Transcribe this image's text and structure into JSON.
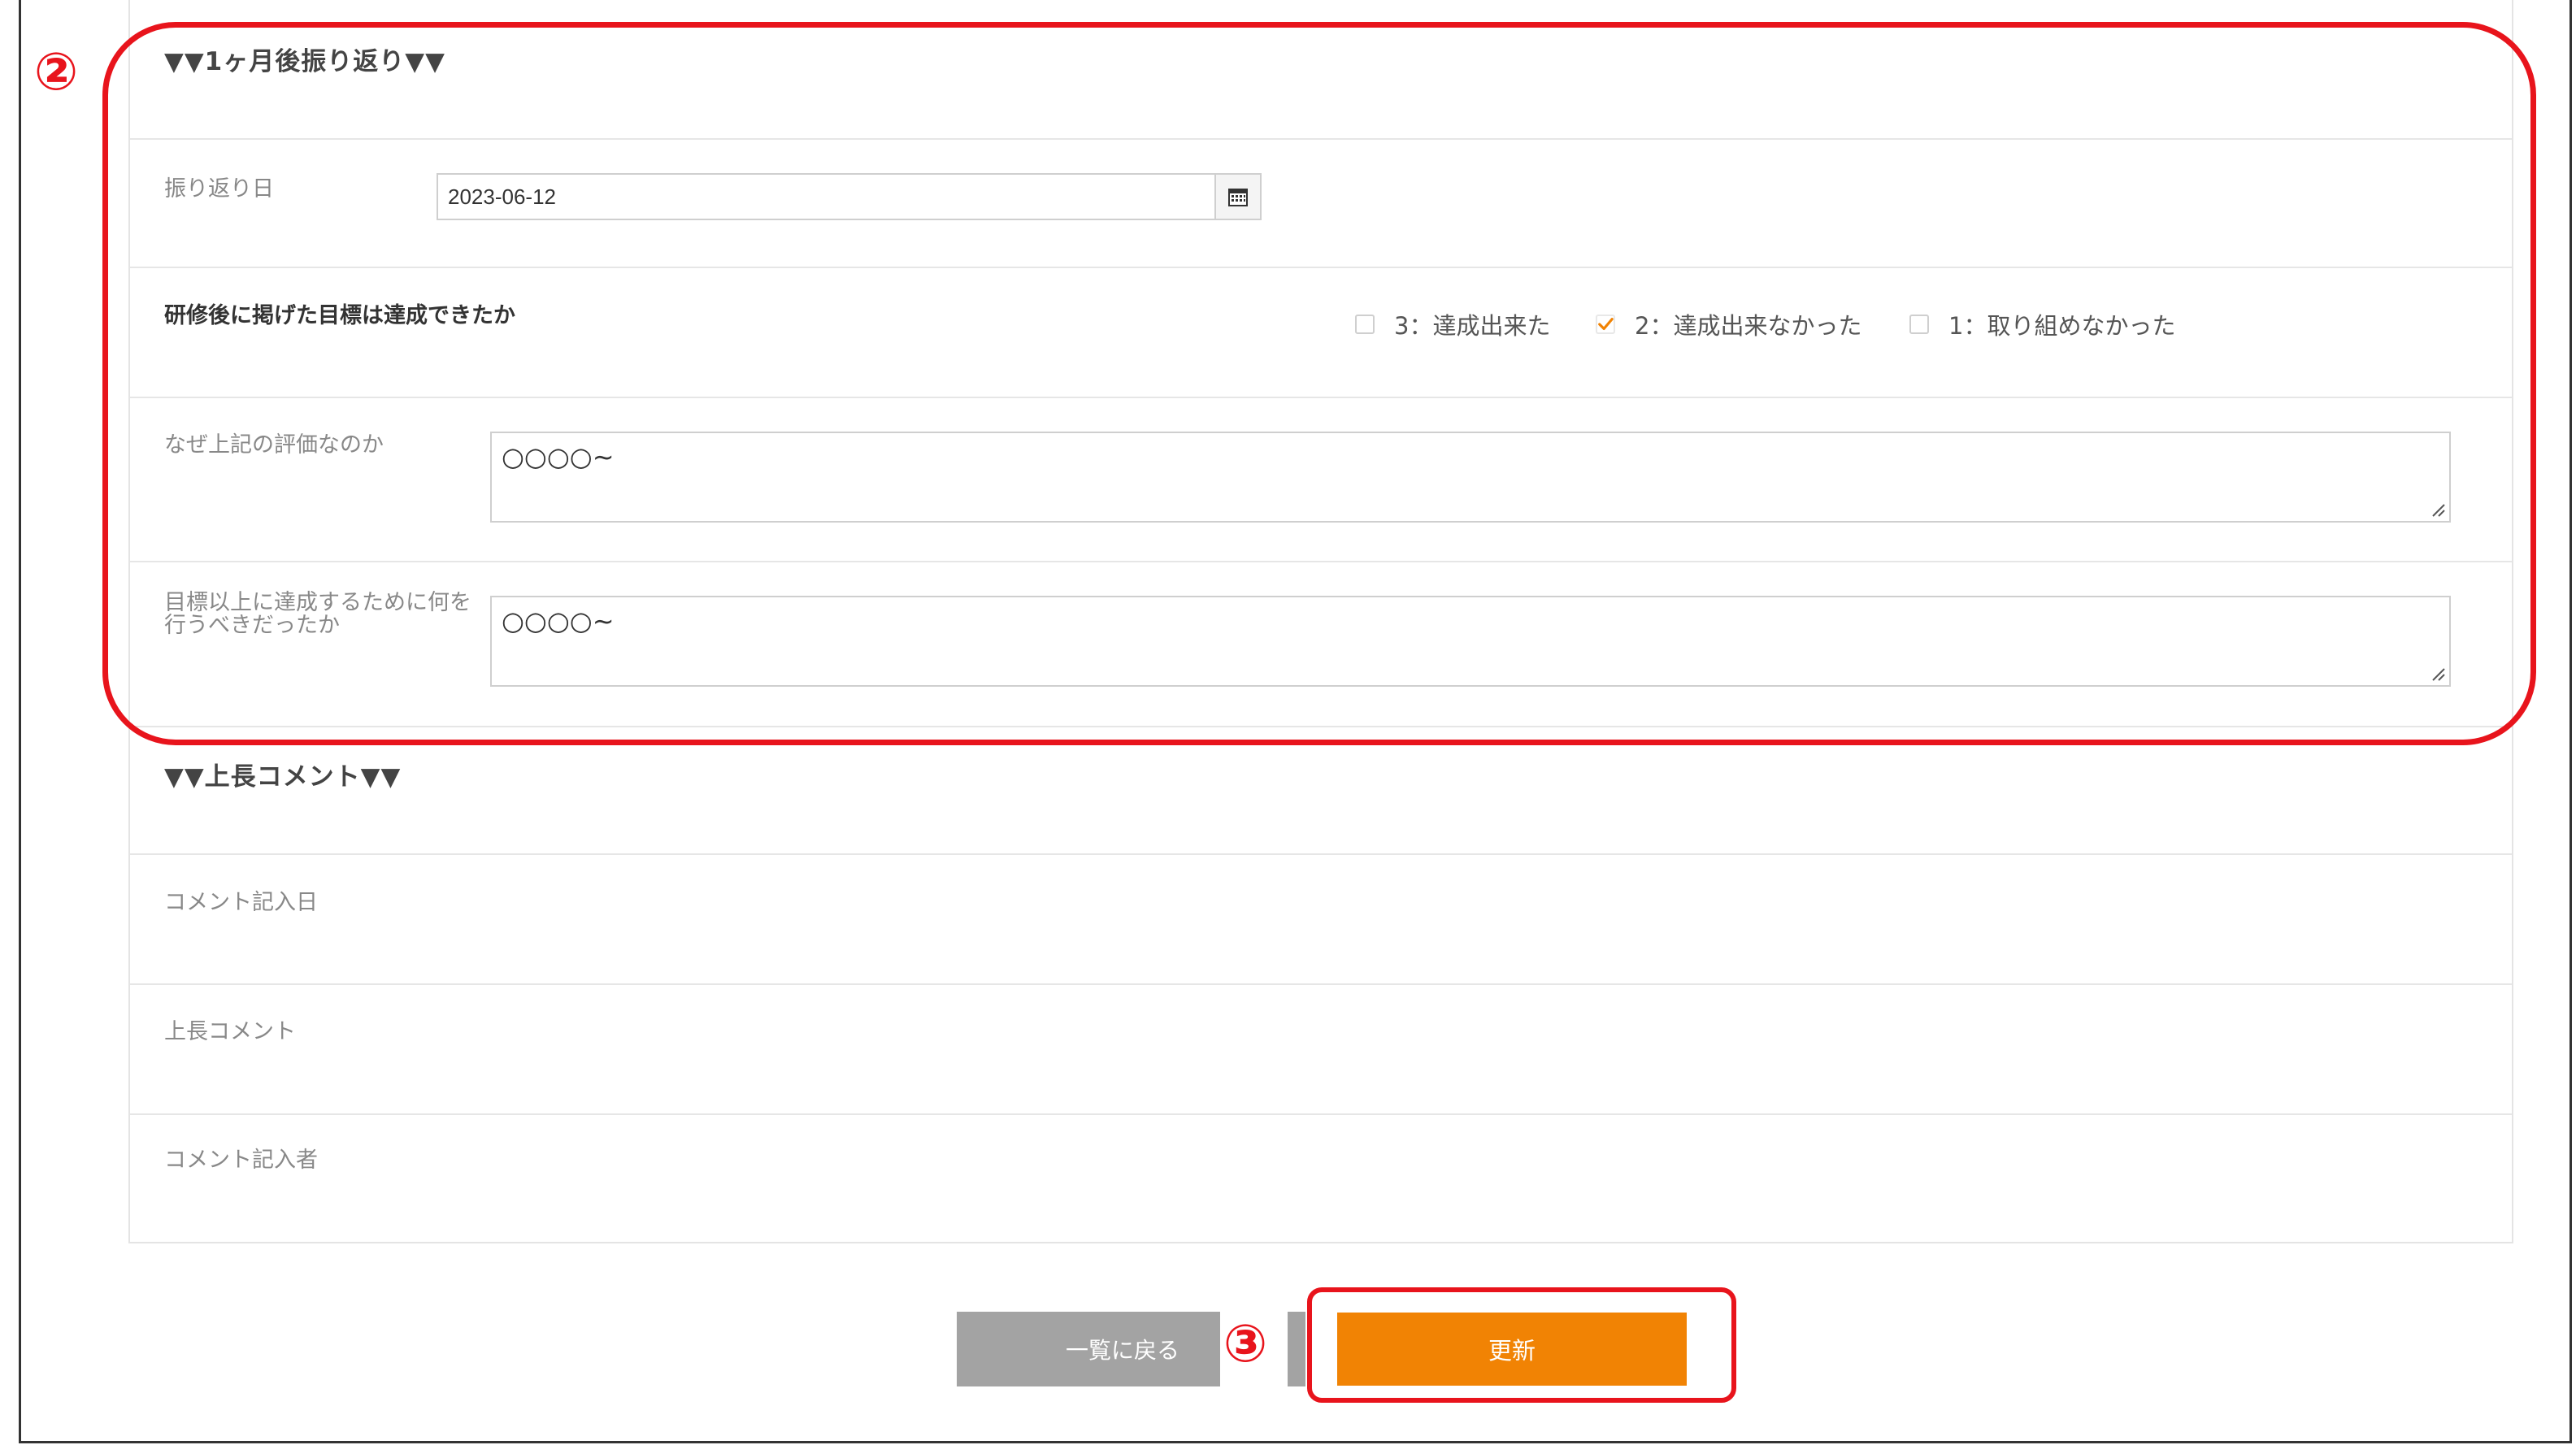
{
  "review_section": {
    "title": "▼▼1ヶ月後振り返り▼▼",
    "date_label": "振り返り日",
    "date_value": "2023-06-12",
    "goal_label": "研修後に掲げた目標は達成できたか",
    "options": [
      {
        "label": "3：達成出来た",
        "checked": false
      },
      {
        "label": "2：達成出来なかった",
        "checked": true
      },
      {
        "label": "1：取り組めなかった",
        "checked": false
      }
    ],
    "reason_label": "なぜ上記の評価なのか",
    "reason_value": "○○○○~",
    "improve_label": "目標以上に達成するために何を行うべきだったか",
    "improve_value": "○○○○~"
  },
  "boss_section": {
    "title": "▼▼上長コメント▼▼",
    "comment_date_label": "コメント記入日",
    "comment_label": "上長コメント",
    "commenter_label": "コメント記入者"
  },
  "buttons": {
    "back_label": "一覧に戻る",
    "update_label": "更新"
  },
  "annotations": {
    "marker_2": "②",
    "marker_3": "③"
  },
  "colors": {
    "accent_orange": "#f18304",
    "annotation_red": "#e8141c",
    "back_button_gray": "#a3a3a3",
    "checkmark": "#f18304"
  }
}
